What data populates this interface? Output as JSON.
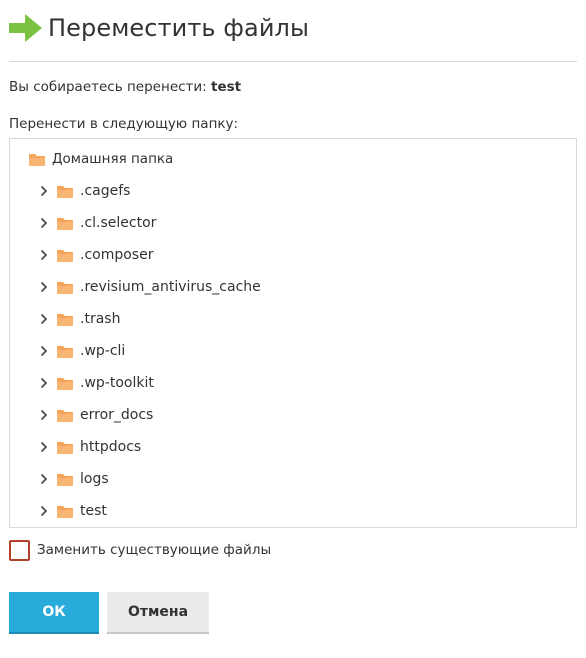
{
  "dialog": {
    "title": "Переместить файлы",
    "move_prefix": "Вы собираетесь перенести: ",
    "move_item": "test",
    "target_label": "Перенести в следующую папку:"
  },
  "tree": {
    "root": {
      "label": "Домашняя папка",
      "icon": "folder-icon"
    },
    "items": [
      {
        "label": ".cagefs"
      },
      {
        "label": ".cl.selector"
      },
      {
        "label": ".composer"
      },
      {
        "label": ".revisium_antivirus_cache"
      },
      {
        "label": ".trash"
      },
      {
        "label": ".wp-cli"
      },
      {
        "label": ".wp-toolkit"
      },
      {
        "label": "error_docs"
      },
      {
        "label": "httpdocs"
      },
      {
        "label": "logs"
      },
      {
        "label": "test"
      }
    ]
  },
  "options": {
    "replace_label": "Заменить существующие файлы",
    "replace_checked": false
  },
  "buttons": {
    "ok": "ОК",
    "cancel": "Отмена"
  },
  "colors": {
    "accent": "#28aadb",
    "folder": "#f5a65b",
    "arrow": "#7cc242",
    "checkbox_border": "#b5402a"
  }
}
